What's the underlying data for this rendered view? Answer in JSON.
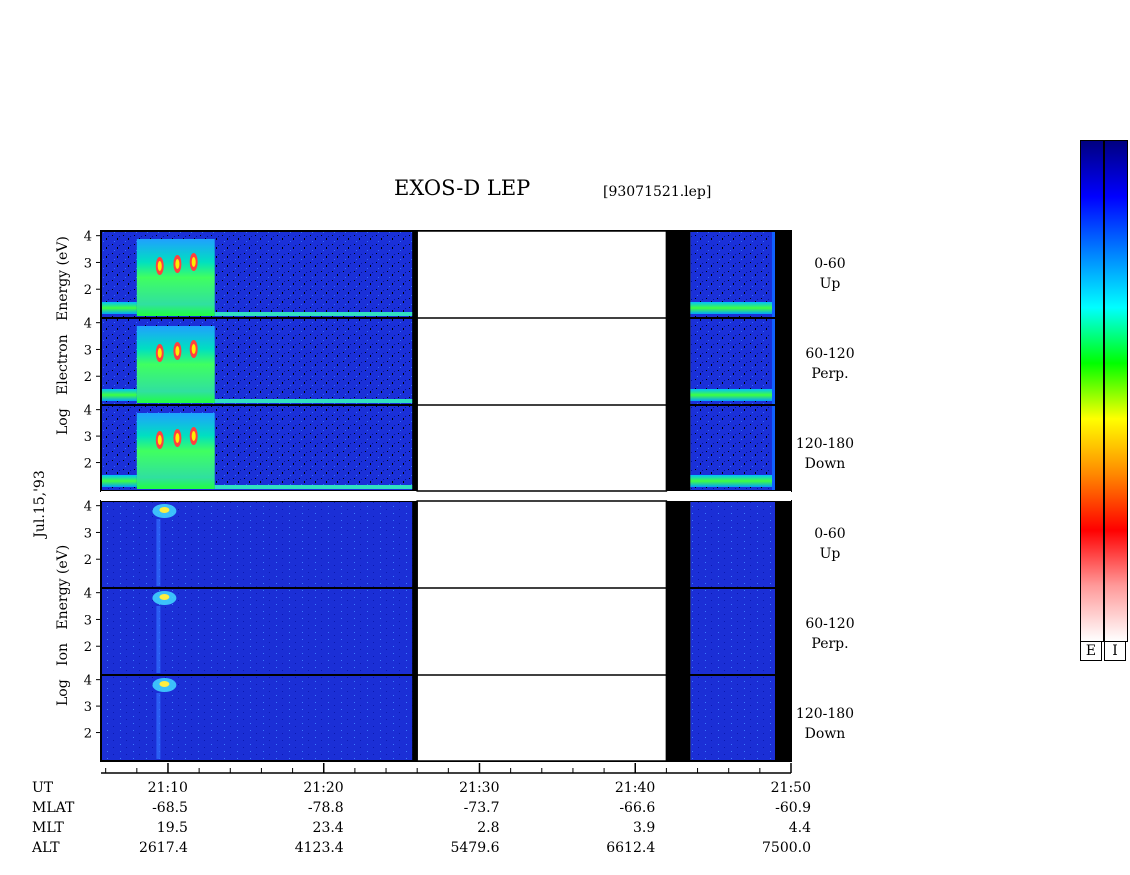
{
  "header": {
    "title": "EXOS-D LEP",
    "file": "[93071521.lep]",
    "date": "Jul.15,'93"
  },
  "y_labels": {
    "electron": [
      "Log",
      "Electron",
      "Energy",
      "(eV)"
    ],
    "ion": [
      "Log",
      "Ion",
      "Energy",
      "(eV)"
    ]
  },
  "panel_labels": {
    "electron": [
      {
        "range": "0-60",
        "dir": "Up"
      },
      {
        "range": "60-120",
        "dir": "Perp."
      },
      {
        "range": "120-180",
        "dir": "Down"
      }
    ],
    "ion": [
      {
        "range": "0-60",
        "dir": "Up"
      },
      {
        "range": "60-120",
        "dir": "Perp."
      },
      {
        "range": "120-180",
        "dir": "Down"
      }
    ]
  },
  "colorbar": {
    "labels": [
      "E",
      "I"
    ],
    "colors": [
      "#ffffff",
      "#ff9999",
      "#ff0000",
      "#ff8800",
      "#ffff00",
      "#00ff00",
      "#00ffff",
      "#0080ff",
      "#0000ff",
      "#000080"
    ]
  },
  "footer": {
    "rows": [
      {
        "name": "UT",
        "values": [
          "21:10",
          "21:20",
          "21:30",
          "21:40",
          "21:50"
        ]
      },
      {
        "name": "MLAT",
        "values": [
          "-68.5",
          "-78.8",
          "-73.7",
          "-66.6",
          "-60.9"
        ]
      },
      {
        "name": "MLT",
        "values": [
          "19.5",
          "23.4",
          "2.8",
          "3.9",
          "4.4"
        ]
      },
      {
        "name": "ALT",
        "values": [
          "2617.4",
          "4123.4",
          "5479.6",
          "6612.4",
          "7500.0"
        ]
      }
    ]
  },
  "chart_data": {
    "type": "heatmap",
    "title": "EXOS-D LEP",
    "x_axis": {
      "label": "UT",
      "ticks": [
        "21:10",
        "21:20",
        "21:30",
        "21:40",
        "21:50"
      ]
    },
    "y_axis": {
      "label": "Log Energy (eV)",
      "ticks": [
        2,
        3,
        4
      ]
    },
    "panels": [
      {
        "species": "Electron",
        "pitch_angle": "0-60",
        "dir": "Up"
      },
      {
        "species": "Electron",
        "pitch_angle": "60-120",
        "dir": "Perp."
      },
      {
        "species": "Electron",
        "pitch_angle": "120-180",
        "dir": "Down"
      },
      {
        "species": "Ion",
        "pitch_angle": "0-60",
        "dir": "Up"
      },
      {
        "species": "Ion",
        "pitch_angle": "60-120",
        "dir": "Perp."
      },
      {
        "species": "Ion",
        "pitch_angle": "120-180",
        "dir": "Down"
      }
    ],
    "data_gap_ut": [
      "21:26",
      "21:42"
    ],
    "electron_burst_ut": [
      "21:08",
      "21:13"
    ],
    "ion_burst_ut": [
      "21:09",
      "21:11"
    ],
    "colorbar_labels": [
      "E",
      "I"
    ]
  }
}
